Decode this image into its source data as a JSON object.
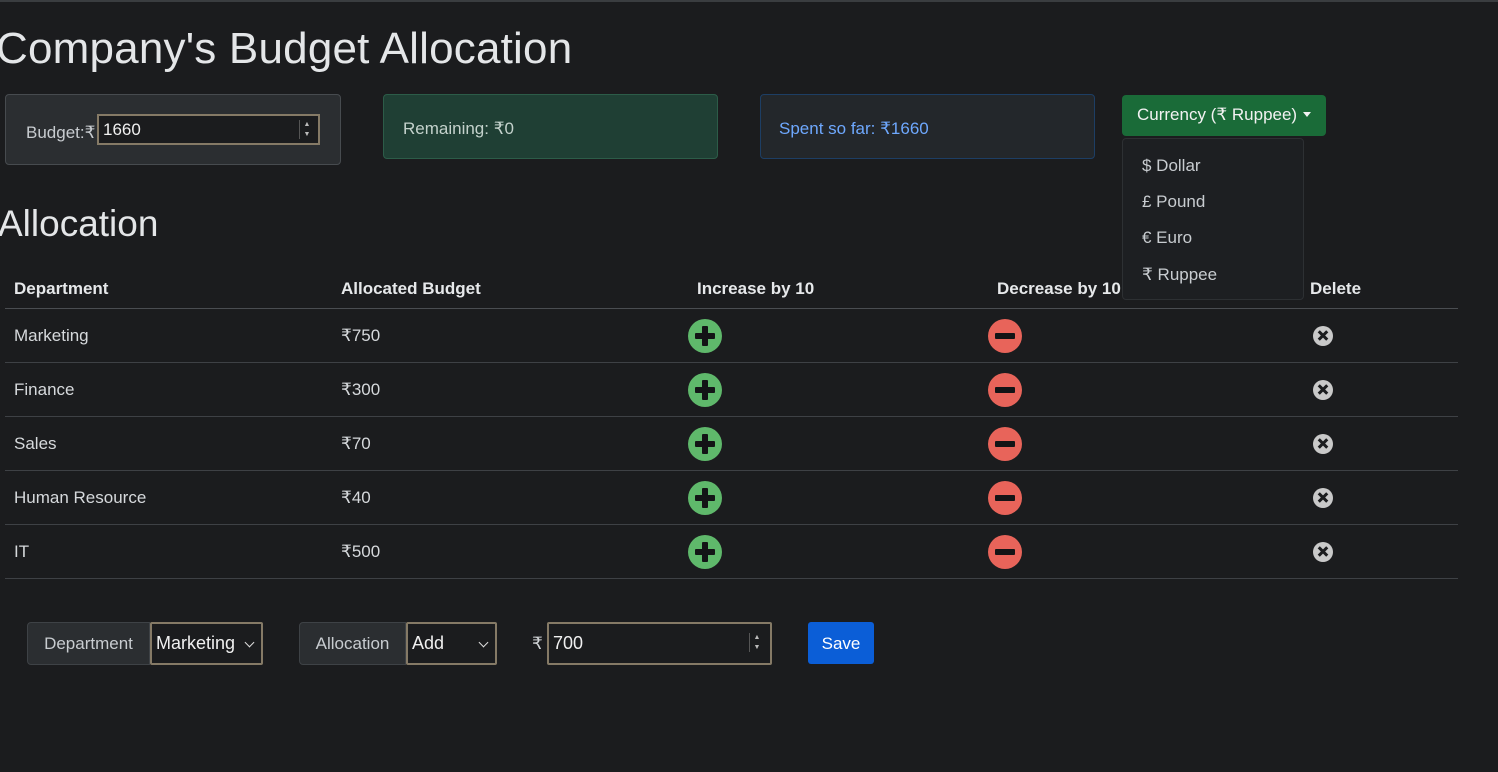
{
  "page": {
    "title": "Company's Budget Allocation",
    "allocation_heading": "Allocation"
  },
  "budget": {
    "label": "Budget:₹",
    "value": "1660"
  },
  "remaining": {
    "text": "Remaining: ₹0"
  },
  "spent": {
    "text": "Spent so far: ₹1660"
  },
  "currency": {
    "button_label": "Currency (₹ Ruppee)",
    "options": [
      {
        "label": "$ Dollar"
      },
      {
        "label": "£ Pound"
      },
      {
        "label": "€ Euro"
      },
      {
        "label": "₹ Ruppee"
      }
    ]
  },
  "table": {
    "headers": [
      "Department",
      "Allocated Budget",
      "Increase by 10",
      "Decrease by 10",
      "Delete"
    ],
    "rows": [
      {
        "department": "Marketing",
        "budget": "₹750"
      },
      {
        "department": "Finance",
        "budget": "₹300"
      },
      {
        "department": "Sales",
        "budget": "₹70"
      },
      {
        "department": "Human Resource",
        "budget": "₹40"
      },
      {
        "department": "IT",
        "budget": "₹500"
      }
    ]
  },
  "form": {
    "department_label": "Department",
    "department_value": "Marketing",
    "allocation_label": "Allocation",
    "allocation_value": "Add",
    "currency_symbol": "₹",
    "amount_value": "700",
    "save_label": "Save"
  },
  "colors": {
    "background": "#1b1c1e",
    "increase": "#5fb86b",
    "decrease": "#e8645a",
    "currency_button": "#1a6b38",
    "save_button": "#0b5ed7",
    "spent_text": "#6ea8fe"
  },
  "icons": {
    "increase": "plus-circle-icon",
    "decrease": "minus-circle-icon",
    "delete": "x-circle-icon"
  }
}
